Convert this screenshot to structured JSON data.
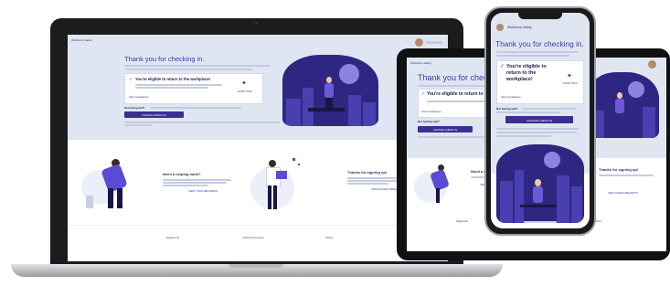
{
  "app": {
    "name": "Workforce Safety"
  },
  "hero": {
    "title": "Thank you for checking in.",
    "eligibility": "You're eligible to return to the workplace!",
    "eligibility_lines": [
      "You're eligible to",
      "return to the",
      "workplace!"
    ],
    "badge_label": "ENTRY PASS",
    "guidelines_link": "View Guidelines",
    "feeling_text": "Not feeling well?",
    "cta_label": "CHANGE CHECK-IN"
  },
  "cards": {
    "help_title": "Need a helping hand?",
    "help_button": "VIEW YOUR REQUESTS",
    "thanks_title": "Thanks for signing up!",
    "thanks_button": "VIEW ACCESS REQUESTS"
  },
  "footer": {
    "links": [
      "Helpful Info",
      "Policy Documents",
      "Others"
    ]
  },
  "colors": {
    "accent": "#3d2f8f",
    "hero_bg": "#dfe6f2",
    "success": "#3cbf4a"
  }
}
